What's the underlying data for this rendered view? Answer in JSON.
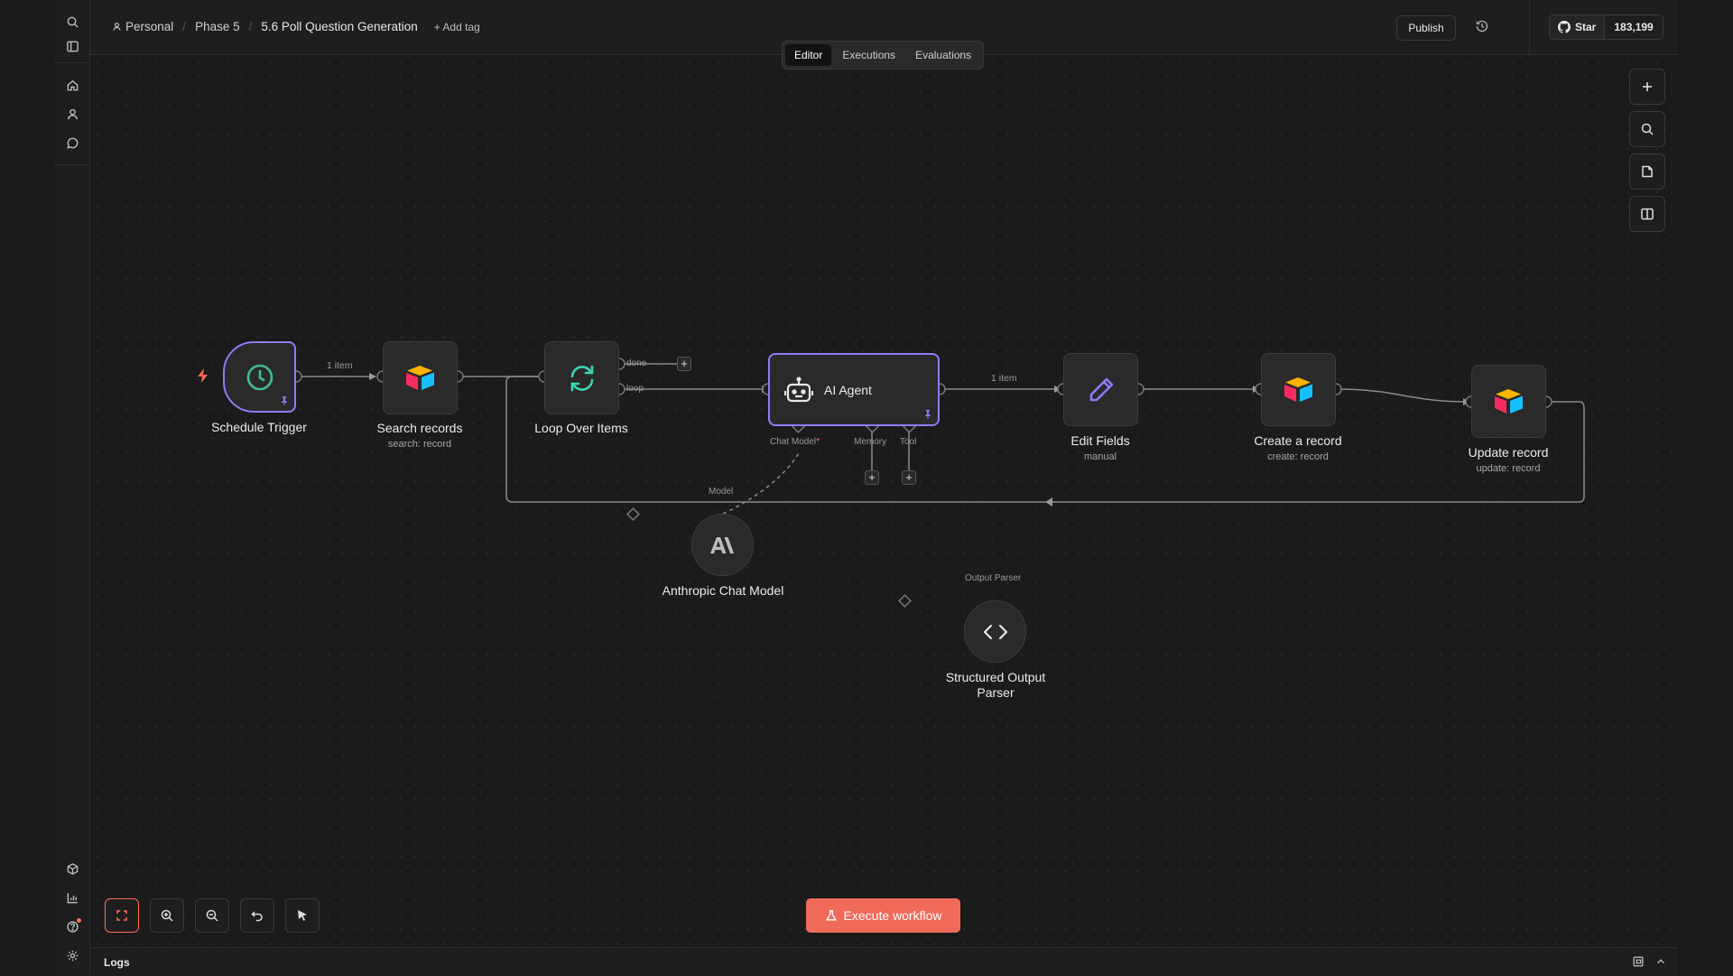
{
  "breadcrumb": {
    "project": "Personal",
    "folder": "Phase 5",
    "workflow": "5.6 Poll Question Generation",
    "add_tag": "+ Add tag"
  },
  "header": {
    "publish_label": "Publish",
    "github_star_label": "Star",
    "github_star_count": "183,199"
  },
  "tabs": [
    {
      "label": "Editor",
      "active": true
    },
    {
      "label": "Executions",
      "active": false
    },
    {
      "label": "Evaluations",
      "active": false
    }
  ],
  "nodes": {
    "schedule_trigger": {
      "title": "Schedule Trigger",
      "icon": "clock-icon"
    },
    "search_records": {
      "title": "Search records",
      "subtitle": "search: record",
      "icon": "airtable-icon"
    },
    "loop_over_items": {
      "title": "Loop Over Items",
      "icon": "loop-icon",
      "done_label": "done",
      "loop_label": "loop"
    },
    "ai_agent": {
      "title": "AI Agent",
      "icon": "robot-icon",
      "chat_model_label": "Chat Model",
      "required_mark": "*",
      "memory_label": "Memory",
      "tool_label": "Tool"
    },
    "edit_fields": {
      "title": "Edit Fields",
      "subtitle": "manual",
      "icon": "pencil-icon"
    },
    "create_record": {
      "title": "Create a record",
      "subtitle": "create: record",
      "icon": "airtable-icon"
    },
    "update_record": {
      "title": "Update record",
      "subtitle": "update: record",
      "icon": "airtable-icon"
    },
    "anthropic_model": {
      "title": "Anthropic Chat Model",
      "port_label": "Model",
      "icon": "anthropic-icon"
    },
    "output_parser": {
      "title": "Structured Output Parser",
      "port_label": "Output Parser",
      "icon": "code-icon"
    }
  },
  "edge_labels": {
    "trigger_to_search": "1 item",
    "agent_to_edit": "1 item"
  },
  "execute_button": "Execute workflow",
  "logs": {
    "title": "Logs"
  },
  "colors": {
    "accent": "#ff6d5a",
    "ai_highlight": "#8b7cf6",
    "canvas": "#1b1b1b",
    "node_bg": "#2a2a2a",
    "loop_icon": "#3fd4b4",
    "trigger_icon": "#3fbf8f"
  }
}
